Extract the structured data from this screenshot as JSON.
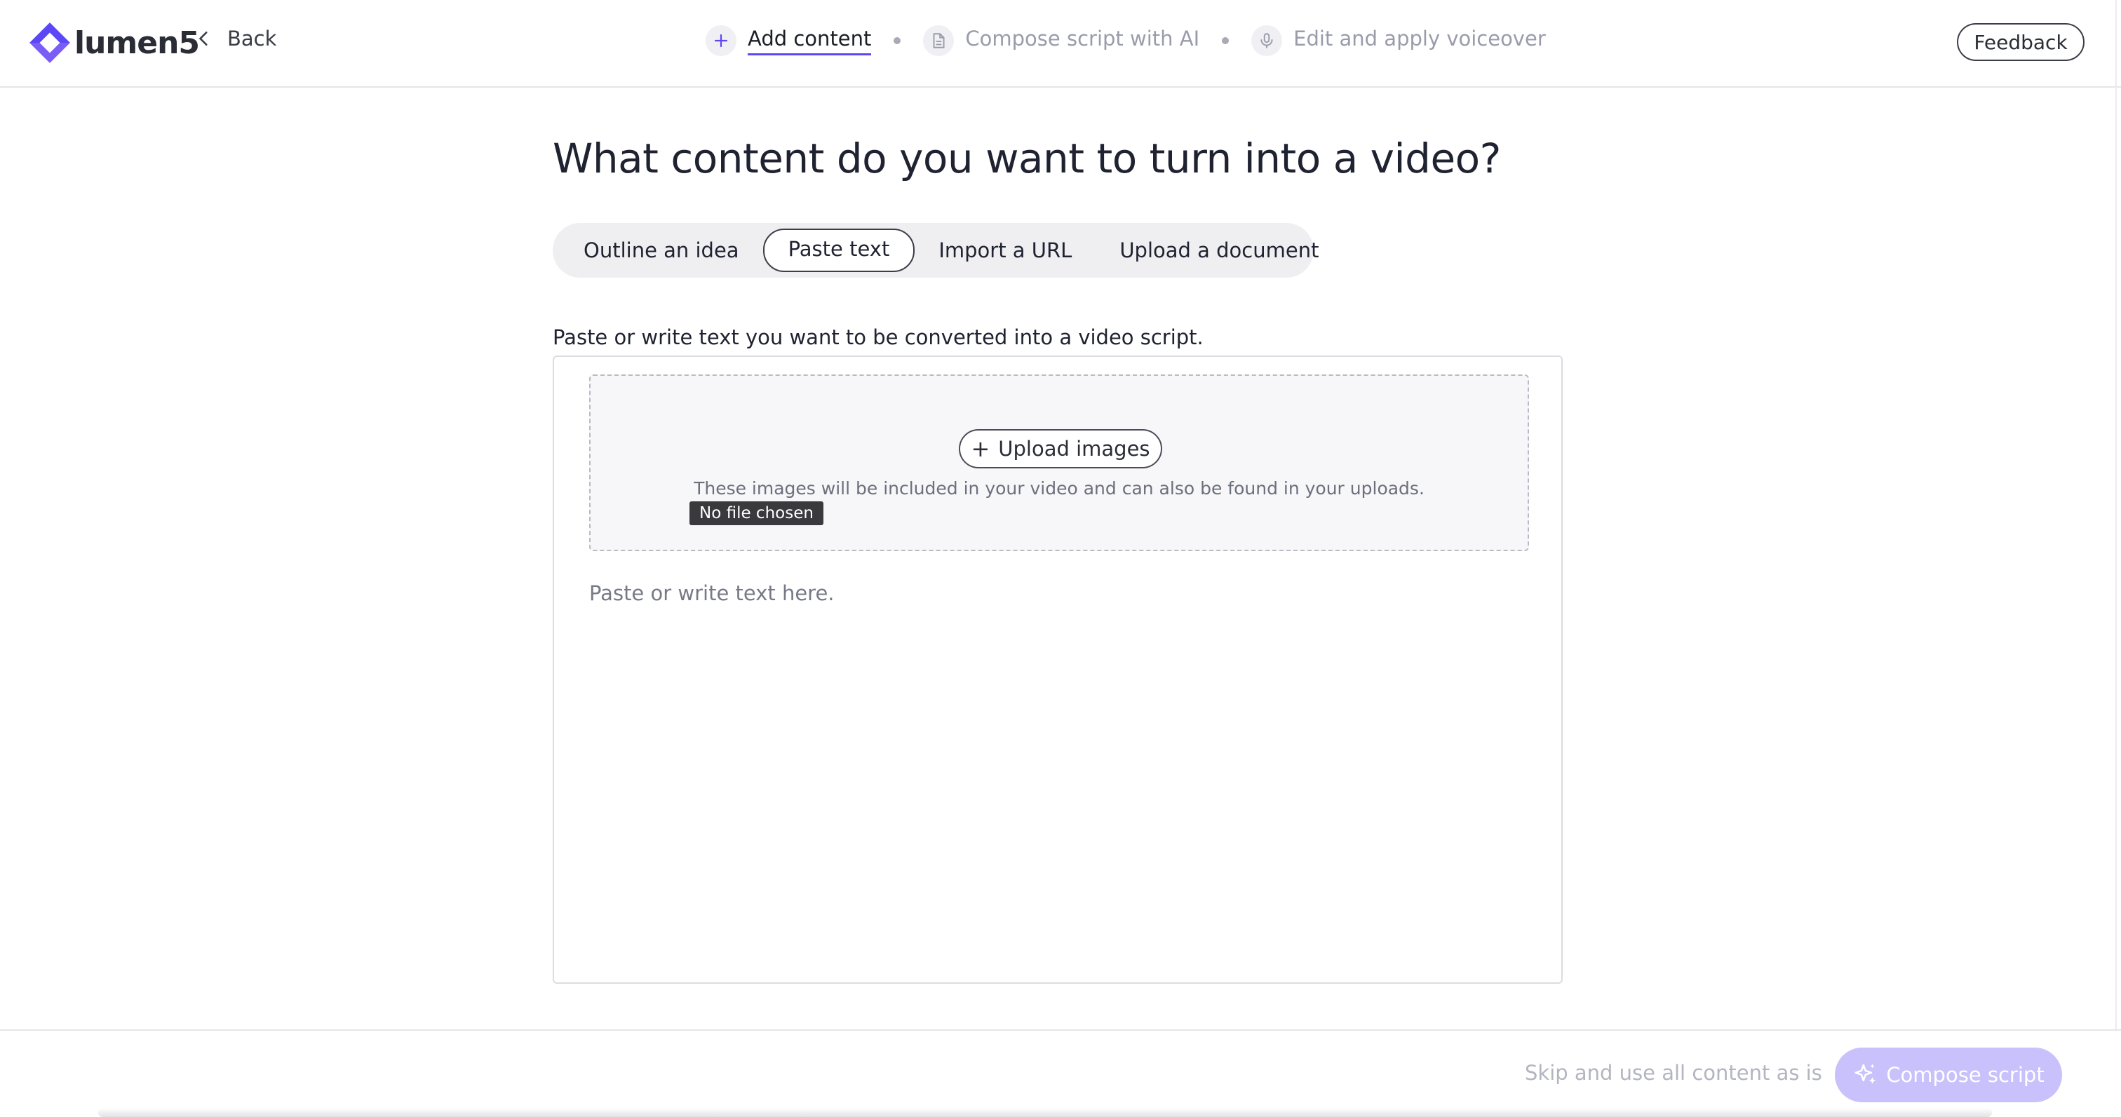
{
  "header": {
    "brand": "lumen5",
    "back_label": "Back",
    "steps": [
      {
        "label": "Add content",
        "icon": "plus-icon",
        "active": true
      },
      {
        "label": "Compose script with AI",
        "icon": "document-icon",
        "active": false
      },
      {
        "label": "Edit and apply voiceover",
        "icon": "microphone-icon",
        "active": false
      }
    ],
    "feedback_label": "Feedback"
  },
  "main": {
    "title": "What content do you want to turn into a video?",
    "tabs": [
      {
        "label": "Outline an idea",
        "active": false
      },
      {
        "label": "Paste text",
        "active": true
      },
      {
        "label": "Import a URL",
        "active": false
      },
      {
        "label": "Upload a document",
        "active": false
      }
    ],
    "instruction": "Paste or write text you want to be converted into a video script.",
    "upload": {
      "button_label": "Upload images",
      "hint": "These images will be included in your video and can also be found in your uploads.",
      "tooltip": "No file chosen"
    },
    "textarea": {
      "value": "",
      "placeholder": "Paste or write text here."
    }
  },
  "footer": {
    "skip_label": "Skip and use all content as is",
    "compose_label": "Compose script"
  },
  "colors": {
    "accent": "#5b47f5",
    "compose_disabled": "#c9c1fb"
  }
}
